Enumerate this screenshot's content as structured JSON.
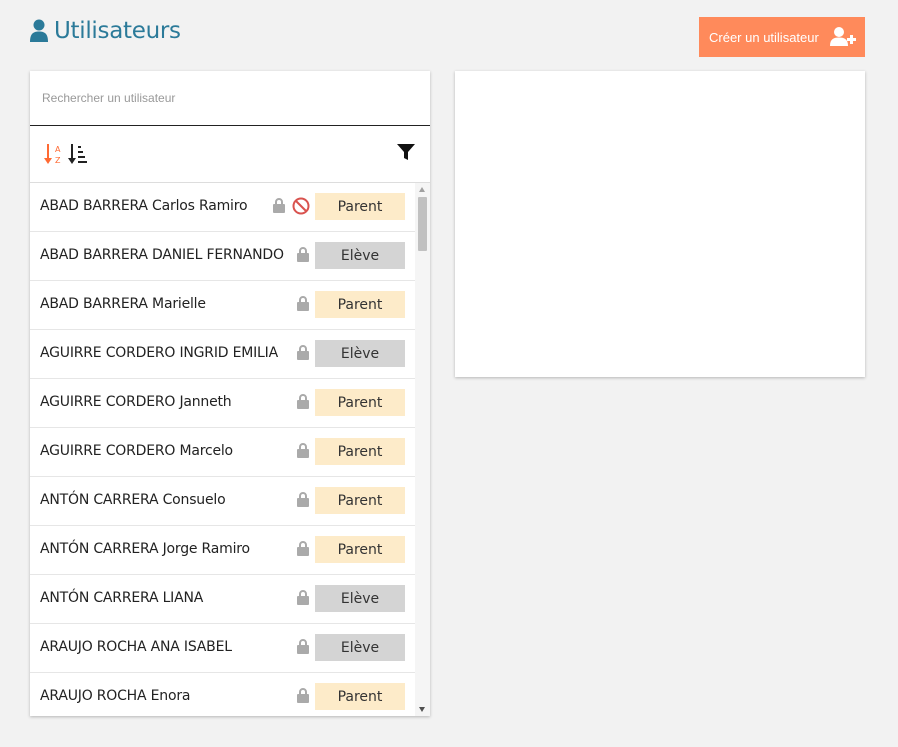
{
  "header": {
    "title": "Utilisateurs",
    "icon": "user-icon"
  },
  "create_button": {
    "label": "Créer un utilisateur",
    "icon": "user-plus-icon",
    "color": "#ff8a5b"
  },
  "search": {
    "placeholder": "Rechercher un utilisateur",
    "value": ""
  },
  "toolbar": {
    "sort_alpha_icon": "sort-alpha-icon",
    "sort_amount_icon": "sort-amount-icon",
    "filter_icon": "filter-icon"
  },
  "users": [
    {
      "name": "ABAD BARRERA Carlos Ramiro",
      "role": "Parent",
      "locked": true,
      "blocked": true
    },
    {
      "name": "ABAD BARRERA DANIEL FERNANDO",
      "role": "Elève",
      "locked": true,
      "blocked": false
    },
    {
      "name": "ABAD BARRERA Marielle",
      "role": "Parent",
      "locked": true,
      "blocked": false
    },
    {
      "name": "AGUIRRE CORDERO INGRID EMILIA",
      "role": "Elève",
      "locked": true,
      "blocked": false
    },
    {
      "name": "AGUIRRE CORDERO Janneth",
      "role": "Parent",
      "locked": true,
      "blocked": false
    },
    {
      "name": "AGUIRRE CORDERO Marcelo",
      "role": "Parent",
      "locked": true,
      "blocked": false
    },
    {
      "name": "ANTÓN CARRERA Consuelo",
      "role": "Parent",
      "locked": true,
      "blocked": false
    },
    {
      "name": "ANTÓN CARRERA Jorge Ramiro",
      "role": "Parent",
      "locked": true,
      "blocked": false
    },
    {
      "name": "ANTÓN CARRERA LIANA",
      "role": "Elève",
      "locked": true,
      "blocked": false
    },
    {
      "name": "ARAUJO ROCHA ANA ISABEL",
      "role": "Elève",
      "locked": true,
      "blocked": false
    },
    {
      "name": "ARAUJO ROCHA Enora",
      "role": "Parent",
      "locked": true,
      "blocked": false
    }
  ],
  "colors": {
    "title": "#2b7a99",
    "parent_badge": "#fdebc9",
    "eleve_badge": "#d4d4d4",
    "accent": "#ff8a5b"
  }
}
